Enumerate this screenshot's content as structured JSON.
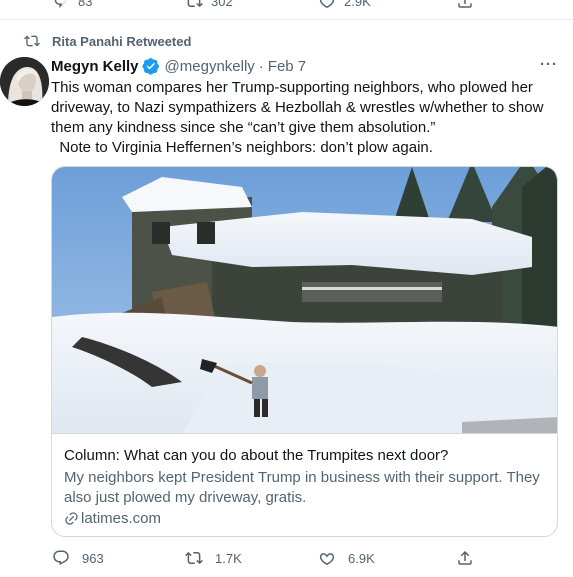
{
  "top_actions": {
    "replies": "83",
    "retweets": "302",
    "likes": "2.9K"
  },
  "retweet_header": "Rita Panahi Retweeted",
  "tweet": {
    "display_name": "Megyn Kelly",
    "handle": "@megynkelly",
    "separator": "·",
    "date": "Feb 7",
    "more": "···",
    "text": "This woman compares her Trump-supporting neighbors, who plowed her driveway, to Nazi sympathizers & Hezbollah & wrestles w/whether to show them any kindness since she “can’t give them absolution.”\n  Note to Virginia Heffernen’s neighbors: don’t plow again."
  },
  "card": {
    "title": "Column: What can you do about the Trumpites next door?",
    "description": "My neighbors kept President Trump in business with their support. They also just plowed my driveway, gratis.",
    "domain": "latimes.com"
  },
  "actions": {
    "replies": "963",
    "retweets": "1.7K",
    "likes": "6.9K"
  },
  "colors": {
    "text": "#0f1419",
    "secondary": "#536471",
    "verified": "#1d9bf0",
    "border": "#cfd9de"
  }
}
